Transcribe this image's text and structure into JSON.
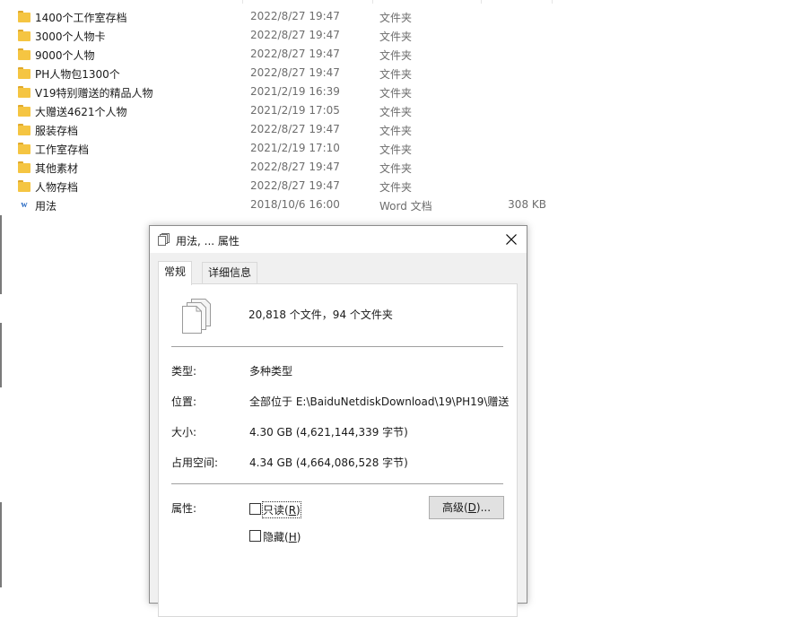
{
  "explorer": {
    "files": [
      {
        "name": "1400个工作室存档",
        "date": "2022/8/27 19:47",
        "type": "文件夹",
        "size": "",
        "icon": "folder-icon"
      },
      {
        "name": "3000个人物卡",
        "date": "2022/8/27 19:47",
        "type": "文件夹",
        "size": "",
        "icon": "folder-icon"
      },
      {
        "name": "9000个人物",
        "date": "2022/8/27 19:47",
        "type": "文件夹",
        "size": "",
        "icon": "folder-icon"
      },
      {
        "name": "PH人物包1300个",
        "date": "2022/8/27 19:47",
        "type": "文件夹",
        "size": "",
        "icon": "folder-icon"
      },
      {
        "name": "V19特别赠送的精品人物",
        "date": "2021/2/19 16:39",
        "type": "文件夹",
        "size": "",
        "icon": "folder-icon"
      },
      {
        "name": "大赠送4621个人物",
        "date": "2021/2/19 17:05",
        "type": "文件夹",
        "size": "",
        "icon": "folder-icon"
      },
      {
        "name": "服装存档",
        "date": "2022/8/27 19:47",
        "type": "文件夹",
        "size": "",
        "icon": "folder-icon"
      },
      {
        "name": "工作室存档",
        "date": "2021/2/19 17:10",
        "type": "文件夹",
        "size": "",
        "icon": "folder-icon"
      },
      {
        "name": "其他素材",
        "date": "2022/8/27 19:47",
        "type": "文件夹",
        "size": "",
        "icon": "folder-icon"
      },
      {
        "name": "人物存档",
        "date": "2022/8/27 19:47",
        "type": "文件夹",
        "size": "",
        "icon": "folder-icon"
      },
      {
        "name": "用法",
        "date": "2018/10/6 16:00",
        "type": "Word 文档",
        "size": "308 KB",
        "icon": "word-document-icon"
      }
    ]
  },
  "dialog": {
    "title": "用法, ... 属性",
    "title_icon": "multiple-files-icon",
    "close_icon": "close-icon",
    "tabs": [
      {
        "label": "常规",
        "active": true
      },
      {
        "label": "详细信息",
        "active": false
      }
    ],
    "summary": "20,818 个文件，94 个文件夹",
    "properties": {
      "type_label": "类型:",
      "type_value": "多种类型",
      "location_label": "位置:",
      "location_value": "全部位于 E:\\BaiduNetdiskDownload\\19\\PH19\\赠送",
      "size_label": "大小:",
      "size_value": "4.30 GB (4,621,144,339 字节)",
      "disk_size_label": "占用空间:",
      "disk_size_value": "4.34 GB (4,664,086,528 字节)"
    },
    "attributes": {
      "label": "属性:",
      "readonly_text": "只读",
      "readonly_key": "R",
      "readonly_checked": false,
      "hidden_text": "隐藏",
      "hidden_key": "H",
      "hidden_checked": false,
      "advanced_text": "高级",
      "advanced_key": "D",
      "advanced_suffix": "..."
    }
  },
  "colors": {
    "folder": "#f5c542",
    "word": "#2b6cc4",
    "dialog_bg": "#f0f0f0",
    "secondary_text": "#6d6d6d"
  }
}
